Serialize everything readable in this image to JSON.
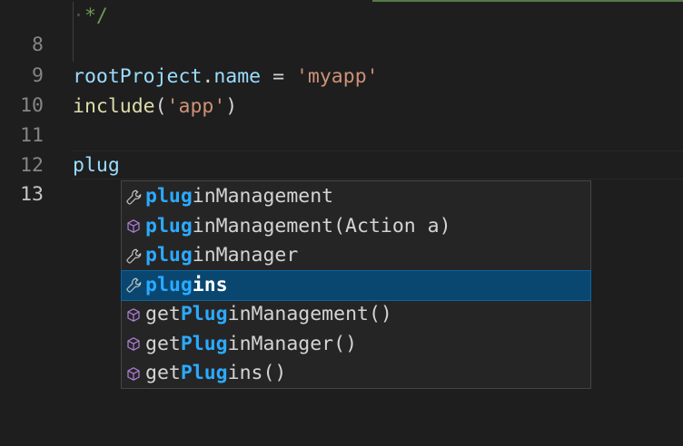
{
  "editor": {
    "lines": [
      {
        "number": "8",
        "comment": "*/"
      },
      {
        "number": "9"
      },
      {
        "number": "10",
        "ident": "rootProject",
        "dot": ".",
        "prop": "name",
        "op": " = ",
        "str": "'myapp'"
      },
      {
        "number": "11",
        "fn": "include",
        "open": "(",
        "str": "'app'",
        "close": ")"
      },
      {
        "number": "12"
      },
      {
        "number": "13",
        "typed": "plug"
      }
    ]
  },
  "suggest": {
    "items": [
      {
        "icon": "wrench-icon",
        "match": "plug",
        "rest": "inManagement",
        "prefix": ""
      },
      {
        "icon": "method-cube-icon",
        "match": "plug",
        "rest": "inManagement(Action a)",
        "prefix": ""
      },
      {
        "icon": "wrench-icon",
        "match": "plug",
        "rest": "inManager",
        "prefix": ""
      },
      {
        "icon": "wrench-icon",
        "match": "plug",
        "rest": "ins",
        "prefix": "",
        "selected": true
      },
      {
        "icon": "method-cube-icon",
        "prefix": "get",
        "match": "Plug",
        "rest": "inManagement()"
      },
      {
        "icon": "method-cube-icon",
        "prefix": "get",
        "match": "Plug",
        "rest": "inManager()"
      },
      {
        "icon": "method-cube-icon",
        "prefix": "get",
        "match": "Plug",
        "rest": "ins()"
      }
    ]
  },
  "colors": {
    "background": "#1e1e1e",
    "selected_item": "#094771",
    "match_highlight": "#2aaaff",
    "property_icon": "#c5c5c5",
    "method_icon": "#b180d7"
  }
}
